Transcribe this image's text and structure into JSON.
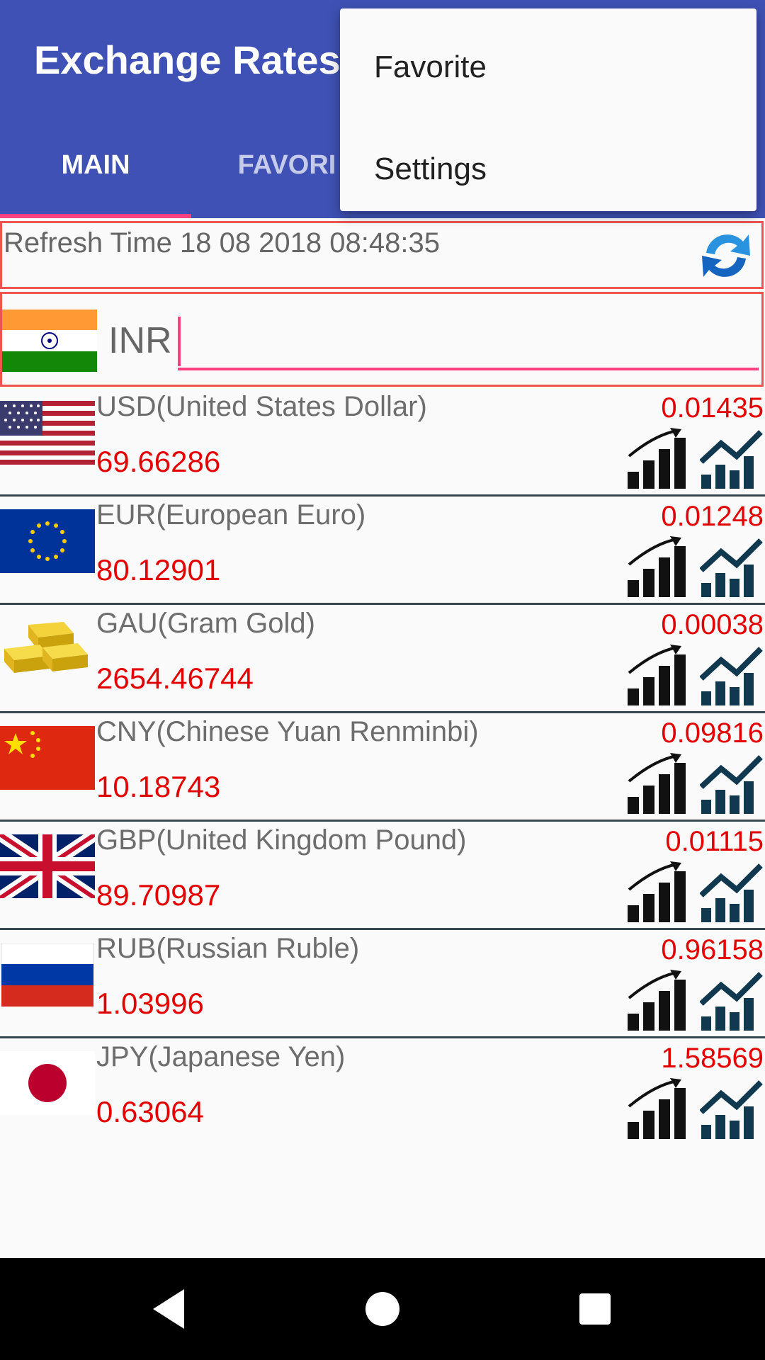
{
  "app": {
    "title": "Exchange Rates",
    "accent_color": "#3f51b5",
    "indicator_color": "#ff4081",
    "tabs": [
      {
        "label": "MAIN",
        "selected": true
      },
      {
        "label": "FAVORI",
        "selected": false
      }
    ]
  },
  "menu": {
    "items": [
      {
        "label": "Favorite"
      },
      {
        "label": "Settings"
      }
    ]
  },
  "refresh": {
    "label": "Refresh Time 18 08 2018 08:48:35",
    "icon": "refresh-icon"
  },
  "base": {
    "code": "INR",
    "flag": "india-flag",
    "value": "",
    "placeholder": ""
  },
  "rows": [
    {
      "name": "USD(United States Dollar)",
      "rate": "69.66286",
      "inverse": "0.01435",
      "flag": "usa-flag"
    },
    {
      "name": "EUR(European Euro)",
      "rate": "80.12901",
      "inverse": "0.01248",
      "flag": "eu-flag"
    },
    {
      "name": "GAU(Gram Gold)",
      "rate": "2654.46744",
      "inverse": "0.00038",
      "flag": "gold-bars"
    },
    {
      "name": "CNY(Chinese Yuan Renminbi)",
      "rate": "10.18743",
      "inverse": "0.09816",
      "flag": "china-flag"
    },
    {
      "name": "GBP(United Kingdom Pound)",
      "rate": "89.70987",
      "inverse": "0.01115",
      "flag": "uk-flag"
    },
    {
      "name": "RUB(Russian Ruble)",
      "rate": "1.03996",
      "inverse": "0.96158",
      "flag": "russia-flag"
    },
    {
      "name": "JPY(Japanese Yen)",
      "rate": "0.63064",
      "inverse": "1.58569",
      "flag": "japan-flag"
    }
  ],
  "navbar": {
    "buttons": [
      "back-icon",
      "home-icon",
      "recents-icon"
    ]
  }
}
